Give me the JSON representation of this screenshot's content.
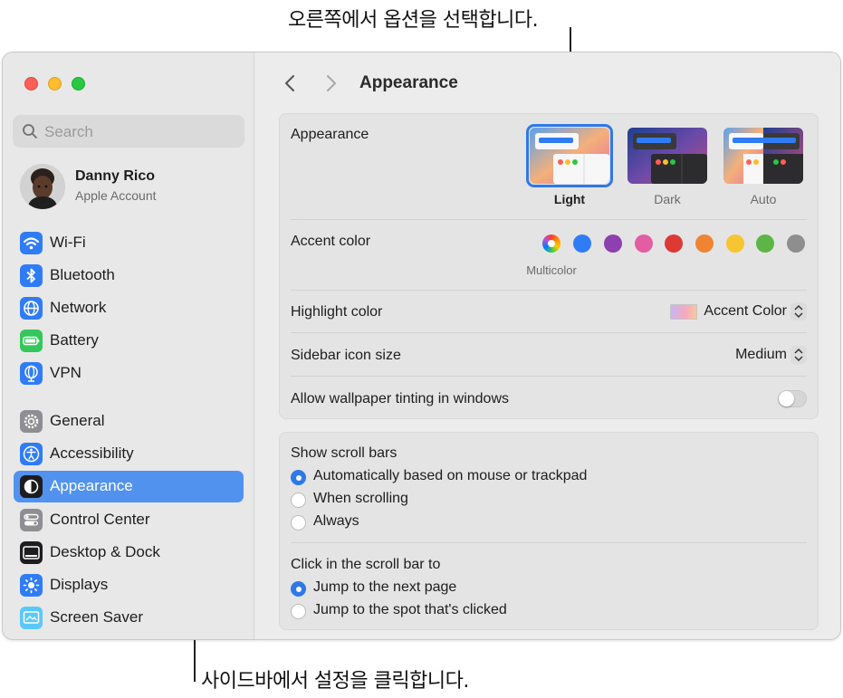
{
  "callouts": {
    "top": "오른쪽에서 옵션을 선택합니다.",
    "bottom": "사이드바에서 설정을 클릭합니다."
  },
  "sidebar": {
    "search_placeholder": "Search",
    "account": {
      "name": "Danny Rico",
      "subtitle": "Apple Account"
    },
    "items": [
      {
        "label": "Wi-Fi",
        "icon": "wifi-icon",
        "color": "#2f7cf6"
      },
      {
        "label": "Bluetooth",
        "icon": "bluetooth-icon",
        "color": "#2f7cf6"
      },
      {
        "label": "Network",
        "icon": "globe-icon",
        "color": "#2f7cf6"
      },
      {
        "label": "Battery",
        "icon": "battery-icon",
        "color": "#34c759"
      },
      {
        "label": "VPN",
        "icon": "vpn-globe-icon",
        "color": "#2f7cf6"
      },
      {
        "label": "General",
        "icon": "gear-icon",
        "color": "#8e8e93"
      },
      {
        "label": "Accessibility",
        "icon": "accessibility-icon",
        "color": "#2f7cf6"
      },
      {
        "label": "Appearance",
        "icon": "appearance-icon",
        "color": "#1d1d1f",
        "active": true
      },
      {
        "label": "Control Center",
        "icon": "control-center-icon",
        "color": "#8e8e93"
      },
      {
        "label": "Desktop & Dock",
        "icon": "desktop-dock-icon",
        "color": "#1d1d1f"
      },
      {
        "label": "Displays",
        "icon": "sun-icon",
        "color": "#2f7cf6"
      },
      {
        "label": "Screen Saver",
        "icon": "screen-saver-icon",
        "color": "#5ac8fa"
      }
    ]
  },
  "main": {
    "title": "Appearance",
    "appearance": {
      "label": "Appearance",
      "options": [
        {
          "label": "Light",
          "selected": true
        },
        {
          "label": "Dark",
          "selected": false
        },
        {
          "label": "Auto",
          "selected": false
        }
      ]
    },
    "accent": {
      "label": "Accent color",
      "selected_label": "Multicolor",
      "colors": [
        "multicolor",
        "#2f7cf6",
        "#8e3fb0",
        "#e45da2",
        "#dd3a35",
        "#ef8433",
        "#f6c531",
        "#5db547",
        "#8e8e8e"
      ]
    },
    "highlight": {
      "label": "Highlight color",
      "value": "Accent Color"
    },
    "sidebar_icon_size": {
      "label": "Sidebar icon size",
      "value": "Medium"
    },
    "wallpaper_tinting": {
      "label": "Allow wallpaper tinting in windows",
      "on": false
    },
    "scroll_bars": {
      "label": "Show scroll bars",
      "options": [
        {
          "label": "Automatically based on mouse or trackpad",
          "selected": true
        },
        {
          "label": "When scrolling",
          "selected": false
        },
        {
          "label": "Always",
          "selected": false
        }
      ]
    },
    "click_scroll": {
      "label": "Click in the scroll bar to",
      "options": [
        {
          "label": "Jump to the next page",
          "selected": true
        },
        {
          "label": "Jump to the spot that's clicked",
          "selected": false
        }
      ]
    }
  }
}
